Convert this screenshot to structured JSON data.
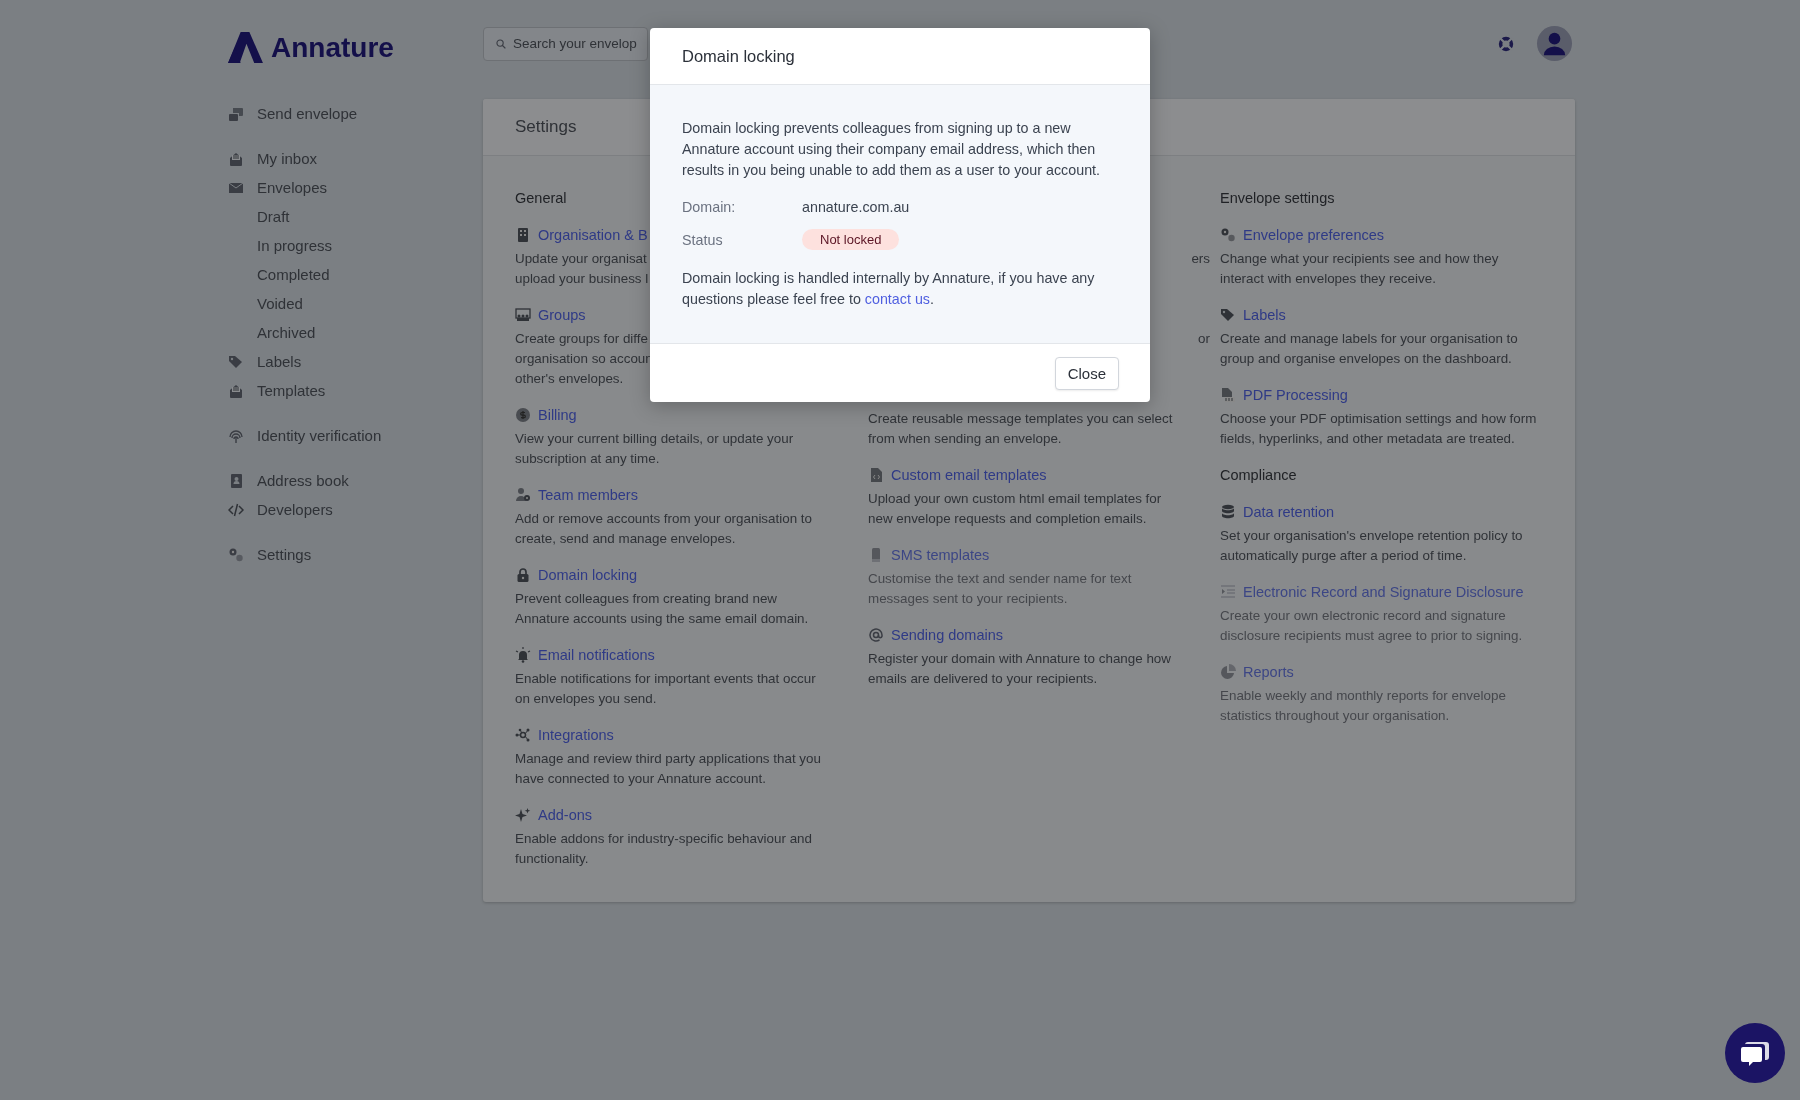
{
  "logo": {
    "text": "Annature"
  },
  "search": {
    "placeholder": "Search your envelop"
  },
  "sidebar": {
    "sections": [
      [
        {
          "label": "Send envelope"
        }
      ],
      [
        {
          "label": "My inbox"
        },
        {
          "label": "Envelopes",
          "children": [
            {
              "label": "Draft"
            },
            {
              "label": "In progress"
            },
            {
              "label": "Completed"
            },
            {
              "label": "Voided"
            },
            {
              "label": "Archived"
            }
          ]
        },
        {
          "label": "Labels"
        },
        {
          "label": "Templates"
        }
      ],
      [
        {
          "label": "Identity verification"
        }
      ],
      [
        {
          "label": "Address book"
        },
        {
          "label": "Developers"
        }
      ],
      [
        {
          "label": "Settings"
        }
      ]
    ]
  },
  "settings": {
    "title": "Settings",
    "columns": [
      {
        "groups": [
          {
            "heading": "General",
            "items": [
              {
                "kind": "full",
                "title": "Organisation & B",
                "lines": [
                  "Update your organisat",
                  "upload your business l"
                ],
                "disabled": false
              },
              {
                "kind": "full",
                "title": "Groups",
                "lines": [
                  "Create groups for diffe",
                  "organisation so accoun",
                  "other's envelopes."
                ],
                "disabled": false
              },
              {
                "kind": "full",
                "title": "Billing",
                "lines": [
                  "View your current billing details, or update your",
                  "subscription at any time."
                ],
                "disabled": false
              },
              {
                "kind": "full",
                "title": "Team members",
                "lines": [
                  "Add or remove accounts from your organisation to",
                  "create, send and manage envelopes."
                ],
                "disabled": false
              },
              {
                "kind": "full",
                "title": "Domain locking",
                "lines": [
                  "Prevent colleagues from creating brand new",
                  "Annature accounts using the same email domain."
                ],
                "disabled": false
              },
              {
                "kind": "full",
                "title": "Email notifications",
                "lines": [
                  "Enable notifications for important events that occur",
                  "on envelopes you send."
                ],
                "disabled": false
              },
              {
                "kind": "full",
                "title": "Integrations",
                "lines": [
                  "Manage and review third party applications that you",
                  "have connected to your Annature account."
                ],
                "disabled": false
              },
              {
                "kind": "full",
                "title": "Add-ons",
                "lines": [
                  "Enable addons for industry-specific behaviour and",
                  "functionality."
                ],
                "disabled": false
              }
            ]
          }
        ]
      },
      {
        "groups": [
          {
            "items": [
              {
                "kind": "tail",
                "lines": [
                  "ers"
                ]
              },
              {
                "kind": "tail",
                "lines": [
                  "or"
                ]
              },
              {
                "kind": "body",
                "lines": [
                  "Create reusable message templates you can select",
                  "from when sending an envelope."
                ]
              },
              {
                "kind": "full",
                "title": "Custom email templates",
                "lines": [
                  "Upload your own custom html email templates for",
                  "new envelope requests and completion emails."
                ],
                "disabled": false
              },
              {
                "kind": "full",
                "title": "SMS templates",
                "lines": [
                  "Customise the text and sender name for text",
                  "messages sent to your recipients."
                ],
                "disabled": true
              },
              {
                "kind": "full",
                "title": "Sending domains",
                "lines": [
                  "Register your domain with Annature to change how",
                  "emails are delivered to your recipients."
                ],
                "disabled": false
              }
            ]
          }
        ]
      },
      {
        "groups": [
          {
            "heading": "Envelope settings",
            "items": [
              {
                "kind": "full",
                "title": "Envelope preferences",
                "lines": [
                  "Change what your recipients see and how they",
                  "interact with envelopes they receive."
                ],
                "disabled": false
              },
              {
                "kind": "full",
                "title": "Labels",
                "lines": [
                  "Create and manage labels for your organisation to",
                  "group and organise envelopes on the dashboard."
                ],
                "disabled": false
              },
              {
                "kind": "full",
                "title": "PDF Processing",
                "lines": [
                  "Choose your PDF optimisation settings and how form",
                  "fields, hyperlinks, and other metadata are treated."
                ],
                "disabled": false
              }
            ]
          },
          {
            "heading": "Compliance",
            "items": [
              {
                "kind": "full",
                "title": "Data retention",
                "lines": [
                  "Set your organisation's envelope retention policy to",
                  "automatically purge after a period of time."
                ],
                "disabled": false
              },
              {
                "kind": "full",
                "title": "Electronic Record and Signature Disclosure",
                "lines": [
                  "Create your own electronic record and signature",
                  "disclosure recipients must agree to prior to signing."
                ],
                "disabled": true
              },
              {
                "kind": "full",
                "title": "Reports",
                "lines": [
                  "Enable weekly and monthly reports for envelope",
                  "statistics throughout your organisation."
                ],
                "disabled": true
              }
            ]
          }
        ]
      }
    ]
  },
  "modal": {
    "title": "Domain locking",
    "intro": "Domain locking prevents colleagues from signing up to a new Annature account using their company email address, which then results in you being unable to add them as a user to your account.",
    "fields": [
      {
        "label": "Domain:",
        "value": "annature.com.au",
        "kind": "text"
      },
      {
        "label": "Status",
        "value": "Not locked",
        "kind": "badge"
      }
    ],
    "note": {
      "text": "Domain locking is handled internally by Annature, if you have any questions please feel free to ",
      "link": "contact us",
      "after": "."
    },
    "button": "Close"
  }
}
